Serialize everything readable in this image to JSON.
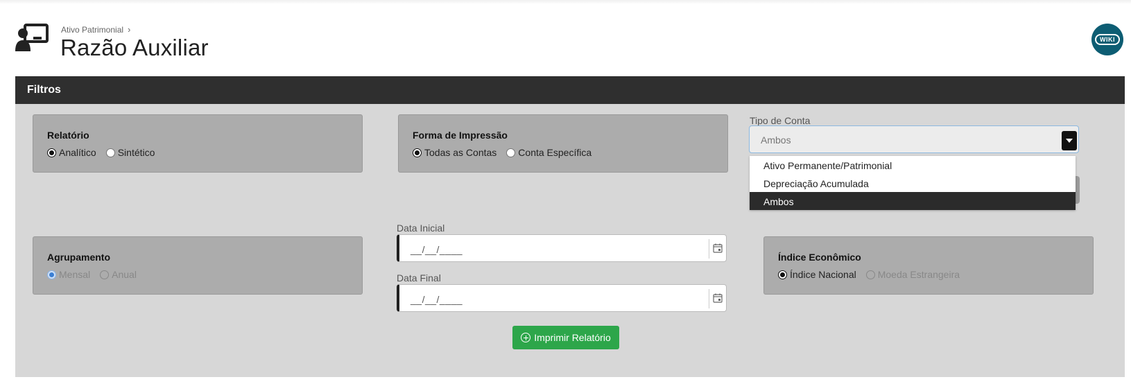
{
  "header": {
    "breadcrumb": "Ativo Patrimonial",
    "title": "Razão Auxiliar",
    "wiki_label": "WIKI"
  },
  "panel": {
    "title": "Filtros"
  },
  "relatorio": {
    "label": "Relatório",
    "options": [
      "Analítico",
      "Sintético"
    ],
    "selected": "Analítico"
  },
  "forma_impressao": {
    "label": "Forma de Impressão",
    "options": [
      "Todas as Contas",
      "Conta Específica"
    ],
    "selected": "Todas as Contas"
  },
  "tipo_conta": {
    "label": "Tipo de Conta",
    "value": "Ambos",
    "options": [
      "Ativo Permanente/Patrimonial",
      "Depreciação Acumulada",
      "Ambos"
    ]
  },
  "agrupamento": {
    "label": "Agrupamento",
    "options": [
      "Mensal",
      "Anual"
    ],
    "selected": "Mensal"
  },
  "data_inicial": {
    "label": "Data Inicial",
    "value": "__/__/____"
  },
  "data_final": {
    "label": "Data Final",
    "value": "__/__/____"
  },
  "indice": {
    "label": "Índice Econômico",
    "options": [
      "Índice Nacional",
      "Moeda Estrangeira"
    ],
    "selected": "Índice Nacional"
  },
  "actions": {
    "print_label": "Imprimir Relatório"
  },
  "colors": {
    "panel_header": "#2f2f2f",
    "panel_body": "#d7d7d7",
    "print_button": "#2da64a",
    "wiki_badge": "#0d5d73"
  }
}
